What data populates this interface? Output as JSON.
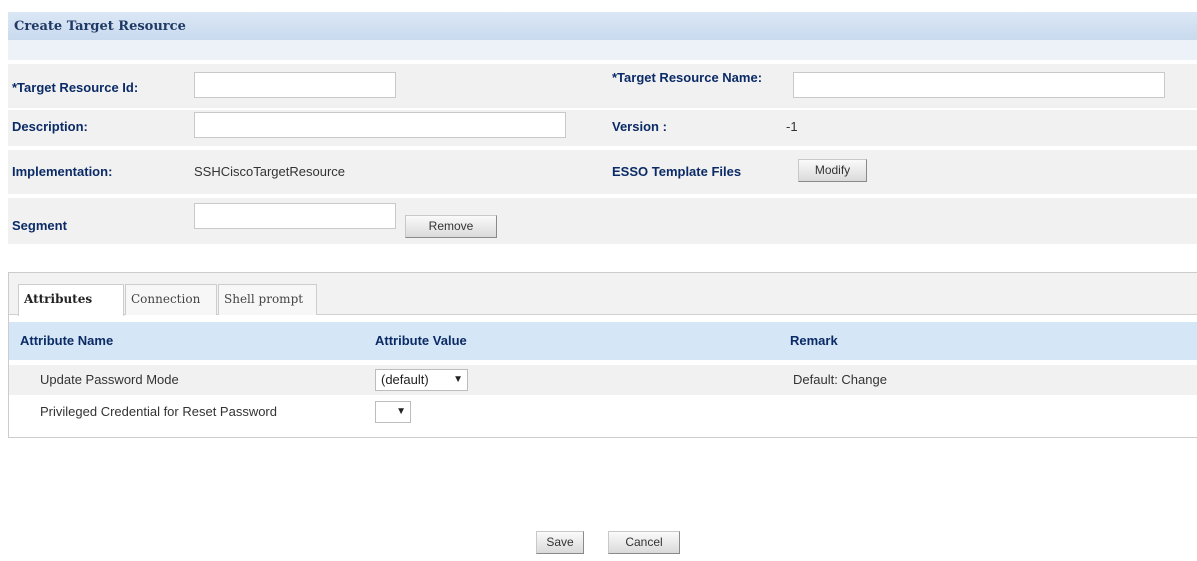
{
  "form": {
    "title": "Create Target Resource",
    "target_resource_id_label": "*Target Resource Id:",
    "target_resource_id_value": "",
    "target_resource_name_label": "*Target Resource Name:",
    "target_resource_name_value": "",
    "description_label": "Description:",
    "description_value": "",
    "version_label": "Version :",
    "version_value": "-1",
    "implementation_label": "Implementation:",
    "implementation_value": "SSHCiscoTargetResource",
    "esso_label": "ESSO Template Files",
    "modify_label": "Modify",
    "segment_label": "Segment",
    "segment_value": "",
    "remove_label": "Remove"
  },
  "tabs": [
    {
      "label": "Attributes",
      "active": true
    },
    {
      "label": "Connection",
      "active": false
    },
    {
      "label": "Shell prompt",
      "active": false
    }
  ],
  "table": {
    "headers": [
      "Attribute Name",
      "Attribute Value",
      "Remark"
    ],
    "rows": [
      {
        "name": "Update Password Mode",
        "value": "(default)",
        "remark": "Default: Change"
      },
      {
        "name": "Privileged Credential for Reset Password",
        "value": "",
        "remark": ""
      }
    ]
  },
  "actions": {
    "save_label": "Save",
    "cancel_label": "Cancel"
  },
  "icons": {
    "dropdown": "chevron-down-icon"
  },
  "colors": {
    "label_text": "#0b2b66",
    "header_bar": "#c9daee",
    "table_header": "#d5e6f6"
  }
}
